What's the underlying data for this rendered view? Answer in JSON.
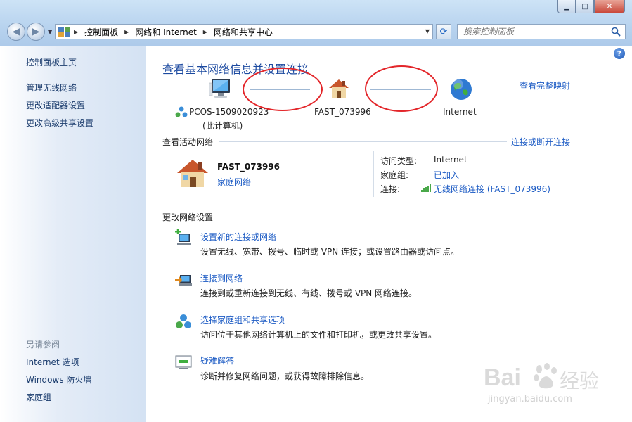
{
  "window": {
    "minimize_label": "▁",
    "maximize_label": "□",
    "close_label": "✕"
  },
  "address_bar": {
    "crumbs": [
      "控制面板",
      "网络和 Internet",
      "网络和共享中心"
    ]
  },
  "search": {
    "placeholder": "搜索控制面板"
  },
  "sidebar": {
    "home": "控制面板主页",
    "links": [
      "管理无线网络",
      "更改适配器设置",
      "更改高级共享设置"
    ],
    "see_also_header": "另请参阅",
    "see_also": [
      "Internet 选项",
      "Windows 防火墙",
      "家庭组"
    ]
  },
  "main": {
    "title": "查看基本网络信息并设置连接",
    "full_map_link": "查看完整映射",
    "map": {
      "computer_name": "PCOS-1509020923",
      "computer_sub": "(此计算机)",
      "router_name": "FAST_073996",
      "internet_name": "Internet"
    },
    "active": {
      "header": "查看活动网络",
      "connect_link": "连接或断开连接",
      "network_name": "FAST_073996",
      "network_type": "家庭网络",
      "access_type_key": "访问类型:",
      "access_type_val": "Internet",
      "homegroup_key": "家庭组:",
      "homegroup_val": "已加入",
      "connection_key": "连接:",
      "connection_val": "无线网络连接 (FAST_073996)"
    },
    "settings": {
      "header": "更改网络设置",
      "tasks": [
        {
          "link": "设置新的连接或网络",
          "desc": "设置无线、宽带、拨号、临时或 VPN 连接；或设置路由器或访问点。"
        },
        {
          "link": "连接到网络",
          "desc": "连接到或重新连接到无线、有线、拨号或 VPN 网络连接。"
        },
        {
          "link": "选择家庭组和共享选项",
          "desc": "访问位于其他网络计算机上的文件和打印机，或更改共享设置。"
        },
        {
          "link": "疑难解答",
          "desc": "诊断并修复网络问题，或获得故障排除信息。"
        }
      ]
    }
  },
  "watermark": {
    "brand": "Bai",
    "brand2": "经验",
    "url": "jingyan.baidu.com"
  },
  "colors": {
    "link": "#1c5bc4",
    "title": "#1c4aa0",
    "annotation": "#e3262a"
  }
}
